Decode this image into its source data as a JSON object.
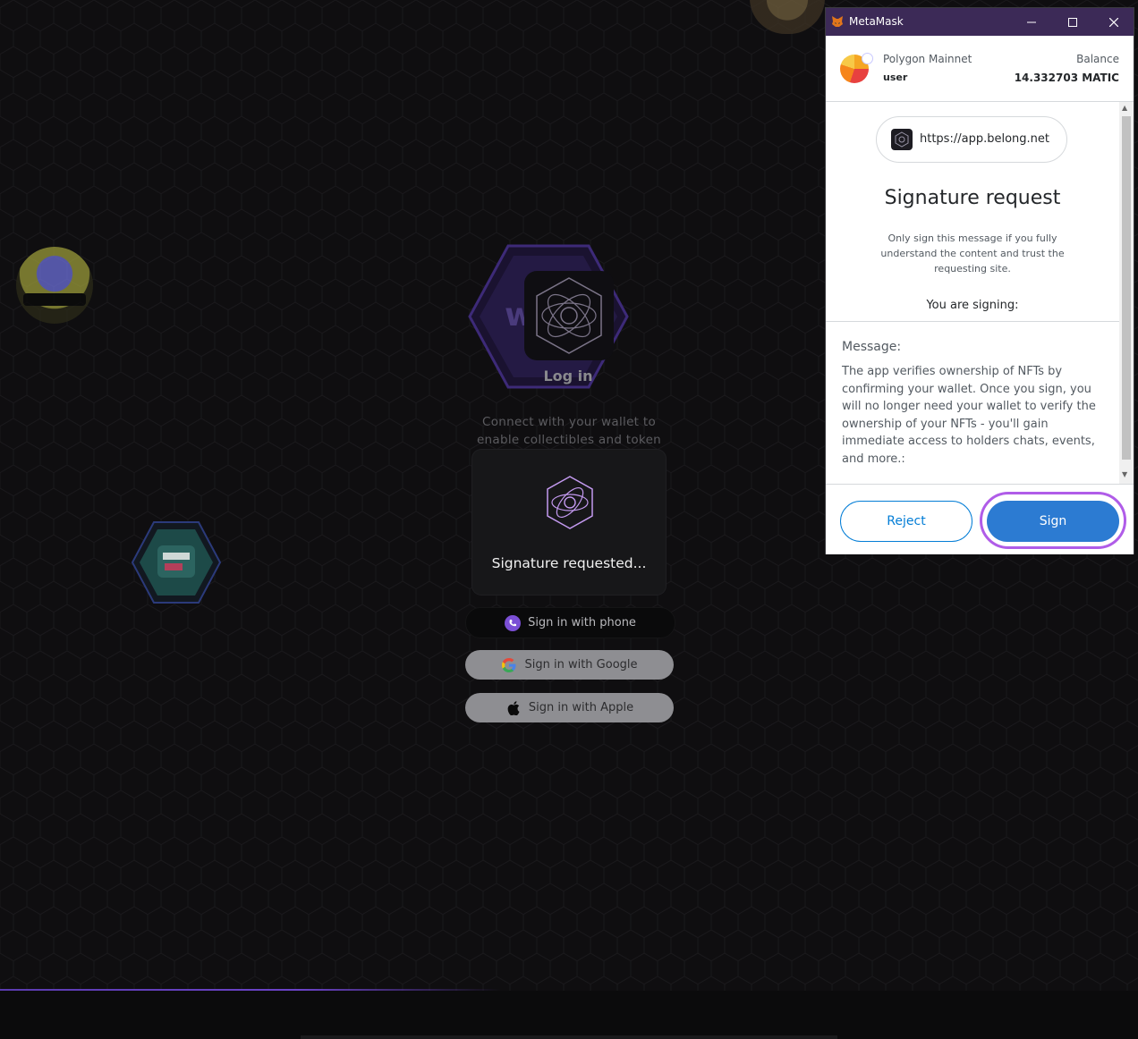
{
  "background": {
    "login_title": "Log in",
    "connect_text": "Connect with your wallet to enable collectibles and token",
    "signature_requested": "Signature requested...",
    "buttons": {
      "phone": "Sign in with phone",
      "google": "Sign in with Google",
      "apple": "Sign in with Apple"
    }
  },
  "metamask": {
    "window_title": "MetaMask",
    "network": "Polygon Mainnet",
    "account": "user",
    "balance_label": "Balance",
    "balance_value": "14.332703 MATIC",
    "origin": "https://app.belong.net",
    "title": "Signature request",
    "warning": "Only sign this message if you fully understand the content and trust the requesting site.",
    "you_are_signing": "You are signing:",
    "message_label": "Message:",
    "message_body": "The app verifies ownership of NFTs by confirming your wallet. Once you sign, you will no longer need your wallet to verify the ownership of your NFTs - you'll gain immediate access to holders chats, events, and more.:",
    "reject_label": "Reject",
    "sign_label": "Sign"
  },
  "colors": {
    "accent_purple": "#b05ce8",
    "metamask_blue": "#037dd6",
    "titlebar": "#3c2a57"
  }
}
